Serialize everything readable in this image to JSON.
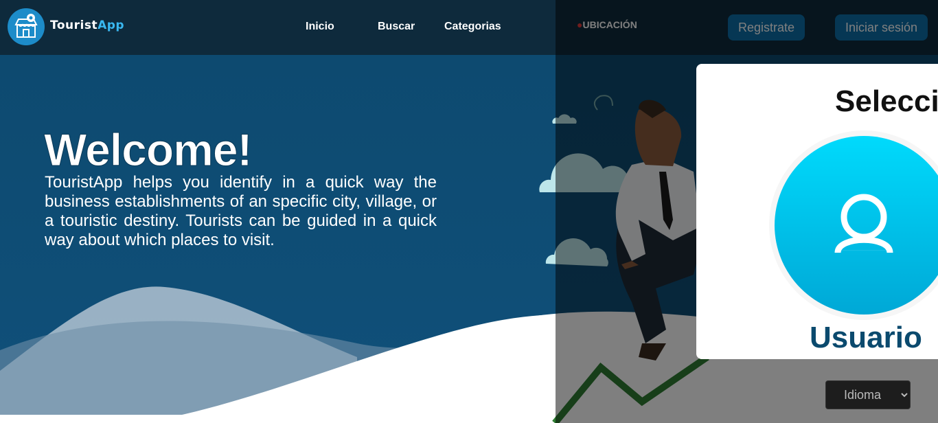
{
  "header": {
    "brand_part1": "Tourist",
    "brand_part2": "App",
    "nav": [
      "Inicio",
      "Buscar",
      "Categorias"
    ],
    "location": "UBICACIÓN",
    "register_label": "Registrate",
    "login_label": "Iniciar sesión"
  },
  "hero": {
    "title": "Welcome!",
    "description": "TouristApp helps you identify in a quick way the business establishments of an specific city, village, or a touristic destiny. Tourists can be guided in a quick way about which places to visit."
  },
  "modal": {
    "title": "Seleccio",
    "option_label": "Usuario"
  },
  "language": {
    "selected": "Idioma"
  },
  "colors": {
    "header": "#0e2a3c",
    "hero": "#0f4c73",
    "accent": "#00c8ef",
    "button": "#0d6ea8"
  },
  "icons": [
    "store-icon",
    "location-pin-icon",
    "user-icon"
  ]
}
